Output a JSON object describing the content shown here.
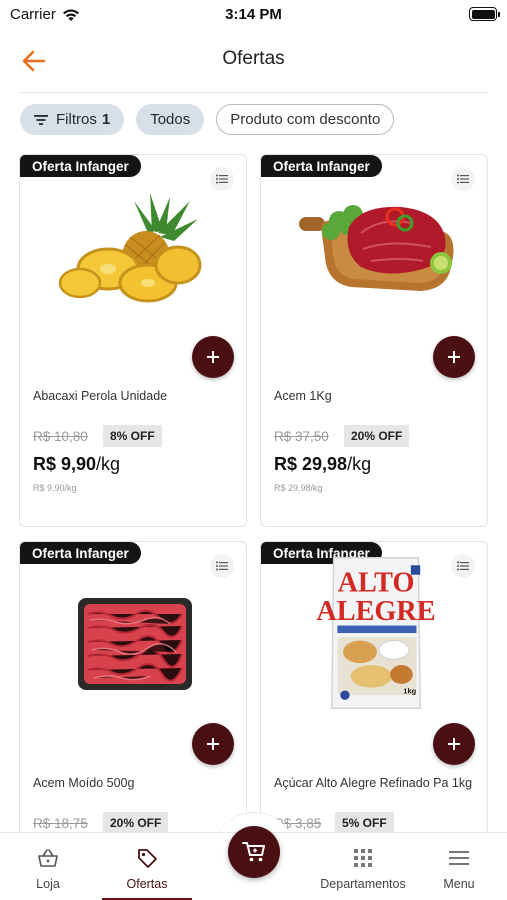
{
  "status_bar": {
    "carrier": "Carrier",
    "time": "3:14 PM"
  },
  "header": {
    "title": "Ofertas",
    "back_icon": "arrow-left-icon"
  },
  "filters": {
    "filter_label": "Filtros",
    "filter_count": "1",
    "todos_label": "Todos",
    "desconto_label": "Produto com desconto"
  },
  "products": [
    {
      "badge": "Oferta Infanger",
      "name": "Abacaxi Perola Unidade",
      "old_price": "R$ 10,80",
      "off": "8% OFF",
      "price": "R$ 9,90",
      "unit": "/kg",
      "unit_price": "R$ 9,90/kg"
    },
    {
      "badge": "Oferta Infanger",
      "name": "Acem 1Kg",
      "old_price": "R$ 37,50",
      "off": "20% OFF",
      "price": "R$ 29,98",
      "unit": "/kg",
      "unit_price": "R$ 29,98/kg"
    },
    {
      "badge": "Oferta Infanger",
      "name": "Acem Moído 500g",
      "old_price": "R$ 18,75",
      "off": "20% OFF"
    },
    {
      "badge": "Oferta Infanger",
      "name": "Açúcar Alto Alegre Refinado Pa 1kg",
      "old_price": "R$ 3,85",
      "off": "5% OFF",
      "brand_line1": "ALTO",
      "brand_line2": "ALEGRE",
      "package_weight": "1kg"
    }
  ],
  "bottom_nav": {
    "loja": "Loja",
    "ofertas": "Ofertas",
    "departamentos": "Departamentos",
    "menu": "Menu"
  },
  "colors": {
    "accent": "#4a0f12",
    "back_arrow": "#e8701e",
    "chip_bg": "#d7dfe8"
  }
}
